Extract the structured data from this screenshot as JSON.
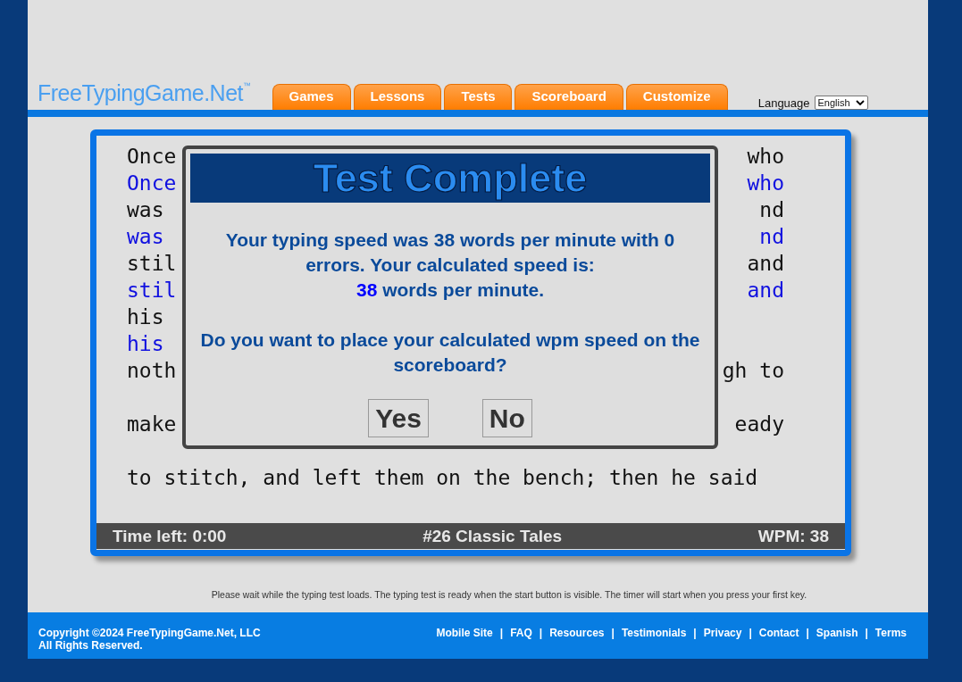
{
  "header": {
    "logo": "FreeTypingGame.Net",
    "logo_mark": "™",
    "tabs": [
      {
        "label": "Games"
      },
      {
        "label": "Lessons"
      },
      {
        "label": "Tests"
      },
      {
        "label": "Scoreboard"
      },
      {
        "label": "Customize"
      }
    ],
    "language_label": "Language",
    "language_value": "English"
  },
  "typing_text": [
    {
      "lines": [
        {
          "left": "Once",
          "right": "who",
          "typed": false
        },
        {
          "left": "Once",
          "right": "who",
          "typed": true
        },
        {
          "left": "was",
          "right": "nd",
          "typed": false
        },
        {
          "left": "was",
          "right": "nd",
          "typed": true
        },
        {
          "left": "stil",
          "right": "and",
          "typed": false
        },
        {
          "left": "stil",
          "right": "and",
          "typed": true
        },
        {
          "left": "his",
          "typed": false
        },
        {
          "left": "his",
          "typed": true
        },
        {
          "left": "noth",
          "right": "gh to",
          "typed": false
        }
      ]
    },
    {
      "lines": [
        {
          "left": "make",
          "right": "eady",
          "typed": false
        }
      ]
    },
    {
      "lines": [
        {
          "left": "to stitch, and left them on the bench; then he said",
          "typed": false
        }
      ]
    }
  ],
  "dialog": {
    "title": "Test Complete",
    "result": "Your typing speed was 38 words per minute with 0 errors. Your calculated speed is:",
    "calculated_wpm": "38",
    "calculated_unit": "words per minute.",
    "question": "Do you want to place your calculated wpm speed on the scoreboard?",
    "buttons": [
      "Yes",
      "No"
    ]
  },
  "status_bar": {
    "time_left": "Time left: 0:00",
    "test_name": "#26 Classic Tales",
    "wpm": "WPM: 38"
  },
  "notice": "Please wait while the typing test loads. The typing test is ready when the start button is visible. The timer will start when you press your first key.",
  "footer": {
    "copyright": "Copyright ©2024 FreeTypingGame.Net, LLC",
    "rights": "All Rights Reserved.",
    "links": [
      "Mobile Site",
      "FAQ",
      "Resources",
      "Testimonials",
      "Privacy",
      "Contact",
      "Spanish",
      "Terms"
    ],
    "separator": "|"
  }
}
